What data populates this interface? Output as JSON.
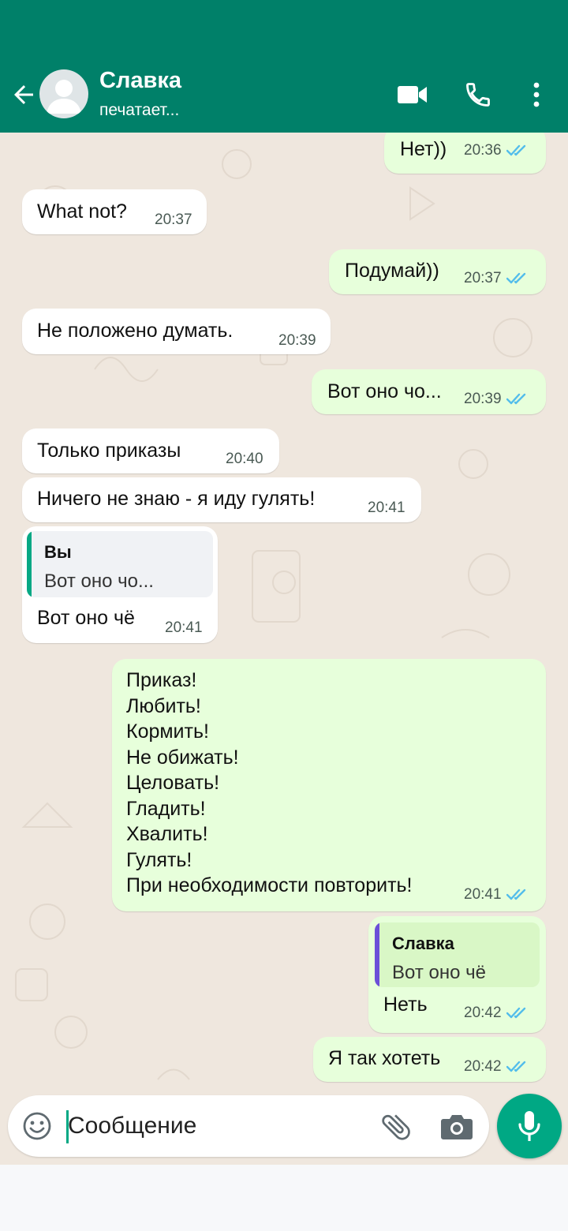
{
  "header": {
    "contact_name": "Славка",
    "status": "печатает...",
    "icons": [
      "back-arrow-icon",
      "avatar-icon",
      "video-call-icon",
      "phone-icon",
      "more-vert-icon"
    ]
  },
  "messages": [
    {
      "dir": "out",
      "text": "Нет))",
      "time": "20:36",
      "read": true
    },
    {
      "dir": "in",
      "text": "What not?",
      "time": "20:37"
    },
    {
      "dir": "out",
      "text": "Подумай))",
      "time": "20:37",
      "read": true
    },
    {
      "dir": "in",
      "text": "Не положено думать.",
      "time": "20:39"
    },
    {
      "dir": "out",
      "text": "Вот оно чо...",
      "time": "20:39",
      "read": true
    },
    {
      "dir": "in",
      "text": "Только приказы",
      "time": "20:40"
    },
    {
      "dir": "in",
      "text": "Ничего не знаю - я иду гулять!",
      "time": "20:41"
    },
    {
      "dir": "in",
      "quote": {
        "author": "Вы",
        "text": "Вот оно чо..."
      },
      "text": "Вот оно чё",
      "time": "20:41"
    },
    {
      "dir": "out",
      "text": "Приказ!\nЛюбить!\nКормить!\nНе обижать!\nЦеловать!\nГладить!\nХвалить!\nГулять!\nПри необходимости повторить!",
      "time": "20:41",
      "read": true
    },
    {
      "dir": "out",
      "quote": {
        "author": "Славка",
        "text": "Вот оно чё"
      },
      "text": "Неть",
      "time": "20:42",
      "read": true
    },
    {
      "dir": "out",
      "text": "Я так хотеть",
      "time": "20:42",
      "read": true
    }
  ],
  "composer": {
    "placeholder": "Сообщение",
    "icons": [
      "emoji-icon",
      "attach-icon",
      "camera-icon",
      "mic-icon"
    ]
  },
  "colors": {
    "header": "#008069",
    "chat_background": "#efe7de",
    "incoming_bubble": "#ffffff",
    "outgoing_bubble": "#e7ffdb",
    "read_ticks": "#53bdeb",
    "accent": "#00a884",
    "quote_bar_you": "#06a884",
    "quote_bar_contact": "#6b4fd8"
  }
}
